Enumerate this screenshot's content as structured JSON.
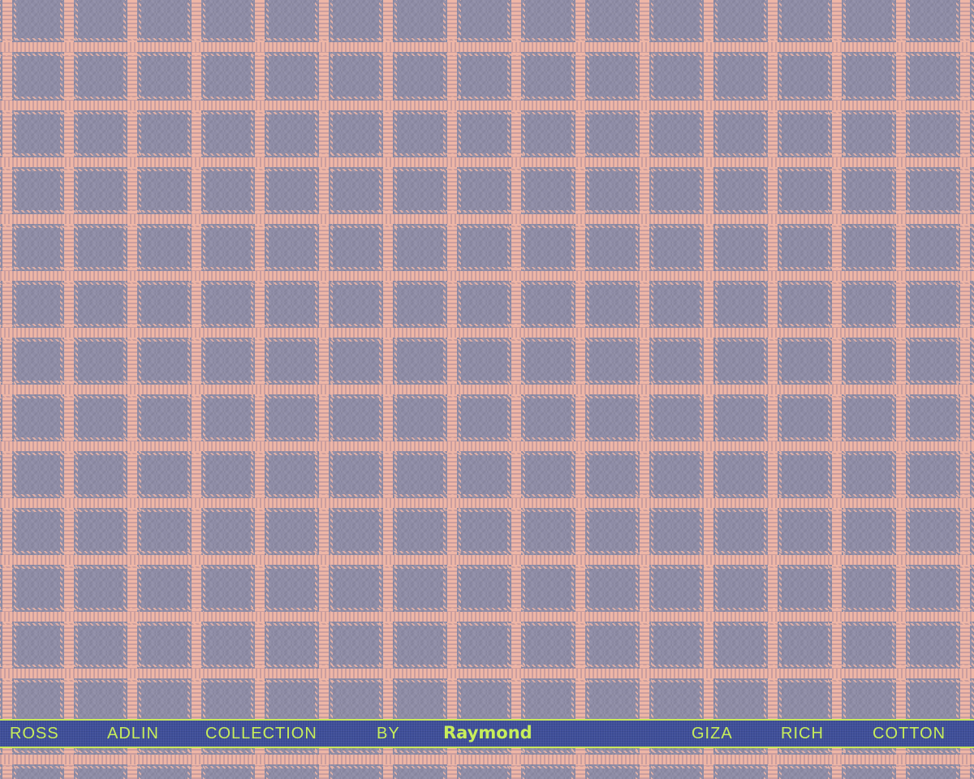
{
  "selvedge": {
    "words": [
      "ROSS",
      "ADLIN",
      "COLLECTION",
      "BY",
      "GIZA",
      "RICH",
      "COTTON"
    ],
    "brand": "Raymond"
  },
  "colors": {
    "ground": "#8e8ca6",
    "check_line": "#eeb6a6",
    "selvedge_band": "#3f4f9a",
    "selvedge_text": "#c7ee5a"
  }
}
